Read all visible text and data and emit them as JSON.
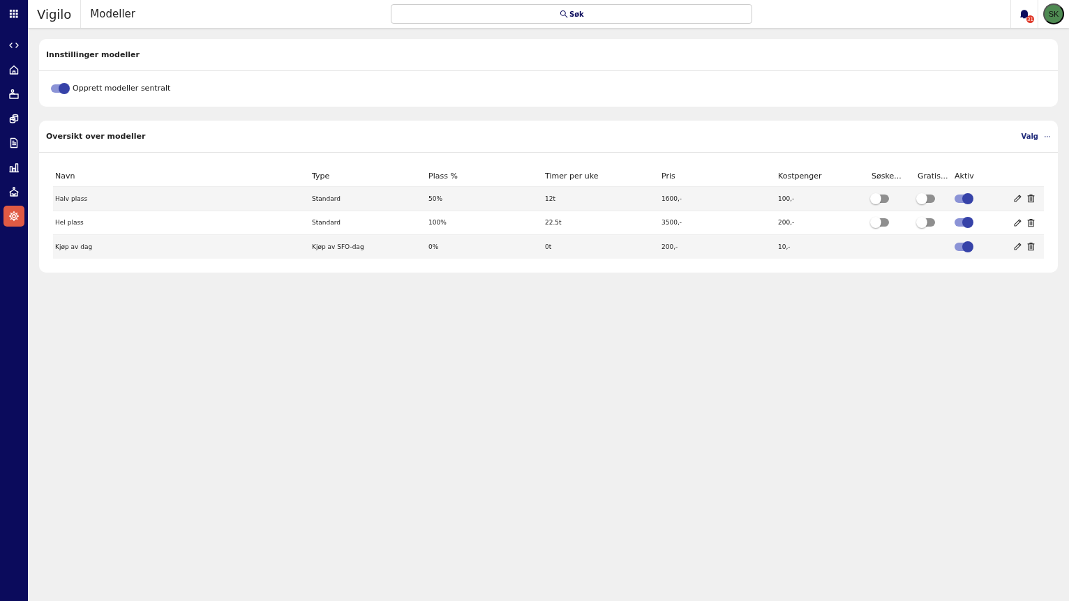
{
  "app": {
    "logo": "Vigilo",
    "title": "Modeller"
  },
  "search": {
    "placeholder": "Søk"
  },
  "notifications": {
    "count": "31"
  },
  "user": {
    "initials": "SK"
  },
  "sidebar": {
    "items": [
      {
        "kind": "code",
        "selected": false
      },
      {
        "kind": "home",
        "selected": false
      },
      {
        "kind": "desk",
        "selected": false
      },
      {
        "kind": "coins",
        "selected": false
      },
      {
        "kind": "document",
        "selected": false
      },
      {
        "kind": "chart",
        "selected": false
      },
      {
        "kind": "building",
        "selected": false
      },
      {
        "kind": "gear",
        "selected": true
      }
    ]
  },
  "settings": {
    "title": "Innstillinger modeller",
    "toggle": {
      "label": "Opprett modeller sentralt",
      "on": true
    }
  },
  "overview": {
    "title": "Oversikt over modeller",
    "action": "Valg",
    "table": {
      "columns": [
        "Navn",
        "Type",
        "Plass %",
        "Timer per uke",
        "Pris",
        "Kostpenger",
        "Søske...",
        "Gratis...",
        "Aktiv"
      ],
      "rows": [
        {
          "cells": [
            "Halv plass",
            "Standard",
            "50%",
            "12t",
            "1600,-",
            "100,-"
          ],
          "sibling": false,
          "free": false,
          "active": true
        },
        {
          "cells": [
            "Hel plass",
            "Standard",
            "100%",
            "22.5t",
            "3500,-",
            "200,-"
          ],
          "sibling": false,
          "free": false,
          "active": true
        },
        {
          "cells": [
            "Kjøp av dag",
            "Kjøp av SFO-dag",
            "0%",
            "0t",
            "200,-",
            "10,-"
          ],
          "active": true
        }
      ]
    }
  }
}
